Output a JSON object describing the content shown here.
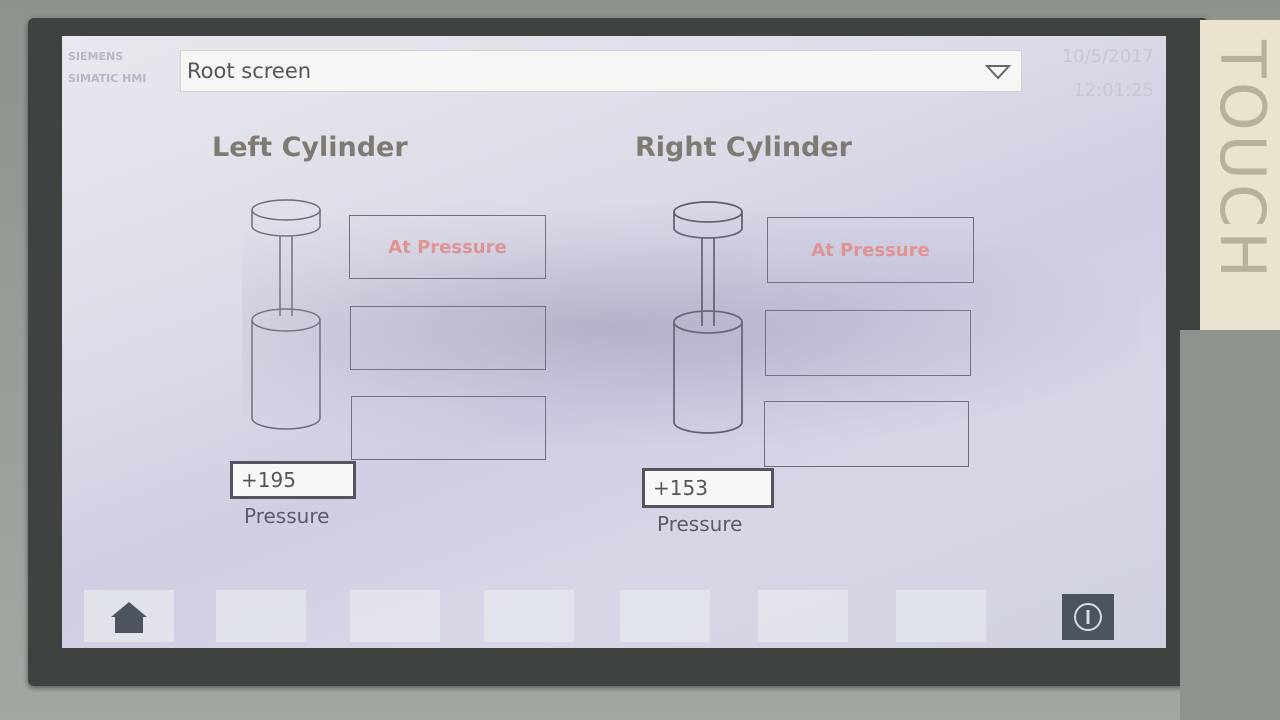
{
  "device": {
    "side_label": "TOUCH"
  },
  "header": {
    "brand_line1": "SIEMENS",
    "brand_line2": "SIMATIC HMI",
    "screen_selector": "Root screen",
    "date": "10/5/2017",
    "time": "12:01:25"
  },
  "left_cylinder": {
    "title": "Left Cylinder",
    "status_1": "At Pressure",
    "status_2": "",
    "status_3": "",
    "pressure_value": "+195",
    "pressure_label": "Pressure"
  },
  "right_cylinder": {
    "title": "Right Cylinder",
    "status_1": "At Pressure",
    "status_2": "",
    "status_3": "",
    "pressure_value": "+153",
    "pressure_label": "Pressure"
  },
  "navbar": {
    "home_icon": "home-icon",
    "info_icon": "info-icon"
  },
  "colors": {
    "status_text": "#e8918c",
    "title_text": "#7e7a72",
    "info_key": "#4c5460"
  }
}
